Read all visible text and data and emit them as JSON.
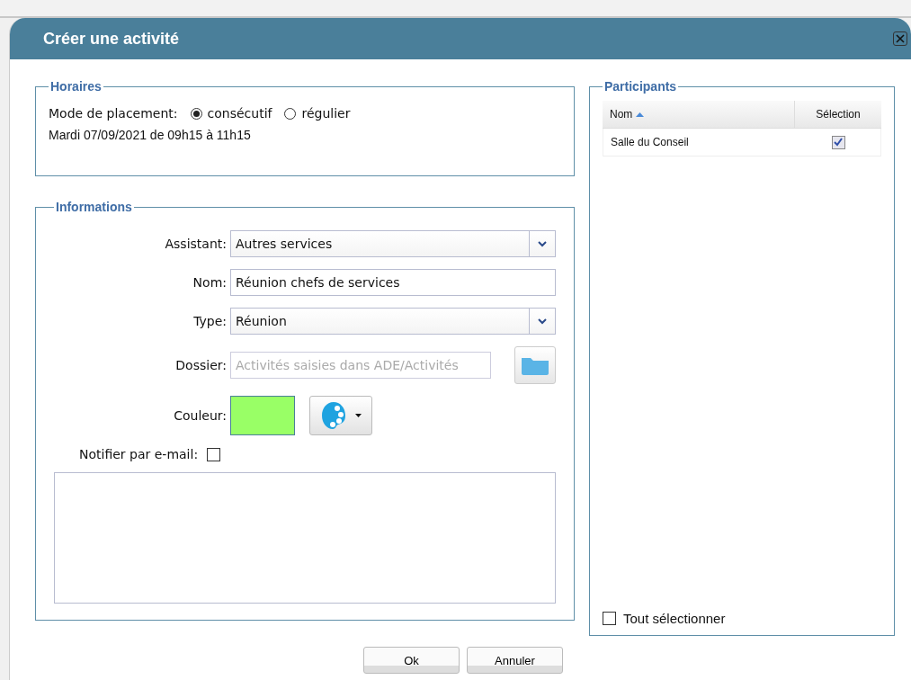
{
  "window": {
    "title": "Créer une activité"
  },
  "horaires": {
    "legend": "Horaires",
    "mode_label": "Mode de placement:",
    "modes": [
      {
        "label": "consécutif",
        "selected": true
      },
      {
        "label": "régulier",
        "selected": false
      }
    ],
    "schedule": "Mardi 07/09/2021 de 09h15 à 11h15"
  },
  "informations": {
    "legend": "Informations",
    "fields": [
      {
        "kind": "select",
        "label": "Assistant:",
        "value": "Autres services"
      },
      {
        "kind": "text",
        "label": "Nom:",
        "value": "Réunion chefs de services"
      },
      {
        "kind": "select",
        "label": "Type:",
        "value": "Réunion"
      },
      {
        "kind": "folder",
        "label": "Dossier:",
        "placeholder": "Activités saisies dans ADE/Activités"
      },
      {
        "kind": "color",
        "label": "Couleur:",
        "color": "#99ff66"
      }
    ],
    "notify": {
      "label": "Notifier par e-mail:",
      "checked": false
    }
  },
  "participants": {
    "legend": "Participants",
    "columns": [
      {
        "label": "Nom",
        "sorted": true
      },
      {
        "label": "Sélection",
        "sorted": false
      }
    ],
    "rows": [
      {
        "name": "Salle du Conseil",
        "checked": true
      }
    ],
    "select_all": {
      "label": "Tout sélectionner",
      "checked": false
    }
  },
  "buttons": [
    "Ok",
    "Annuler"
  ]
}
